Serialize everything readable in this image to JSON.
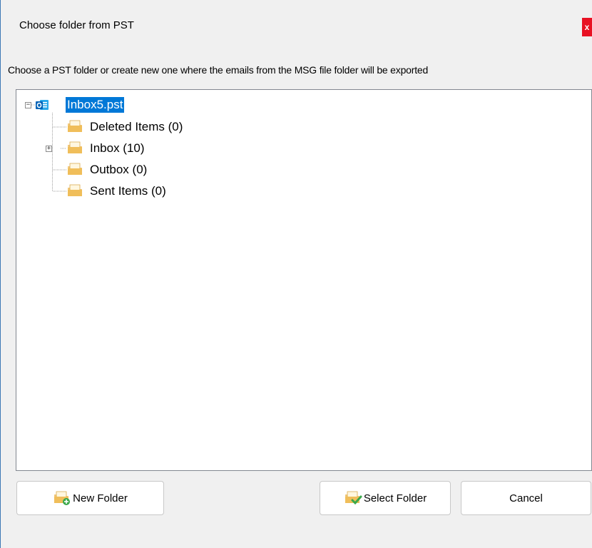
{
  "window": {
    "title": "Choose folder from PST",
    "close_label": "x"
  },
  "instruction": "Choose a PST folder or create new one where the emails from the MSG file folder will be exported",
  "tree": {
    "root": {
      "label": "Inbox5.pst",
      "icon": "outlook-pst-icon",
      "expanded": true,
      "selected": true
    },
    "children": [
      {
        "label": "Deleted Items (0)",
        "icon": "mail-folder-icon",
        "expandable": false
      },
      {
        "label": "Inbox (10)",
        "icon": "mail-folder-icon",
        "expandable": true
      },
      {
        "label": "Outbox (0)",
        "icon": "mail-folder-icon",
        "expandable": false
      },
      {
        "label": "Sent Items (0)",
        "icon": "mail-folder-icon",
        "expandable": false
      }
    ]
  },
  "buttons": {
    "new_folder": "New Folder",
    "select_folder": "Select Folder",
    "cancel": "Cancel"
  },
  "colors": {
    "selection": "#0078d7",
    "close": "#e81123",
    "folder": "#f0c060"
  }
}
